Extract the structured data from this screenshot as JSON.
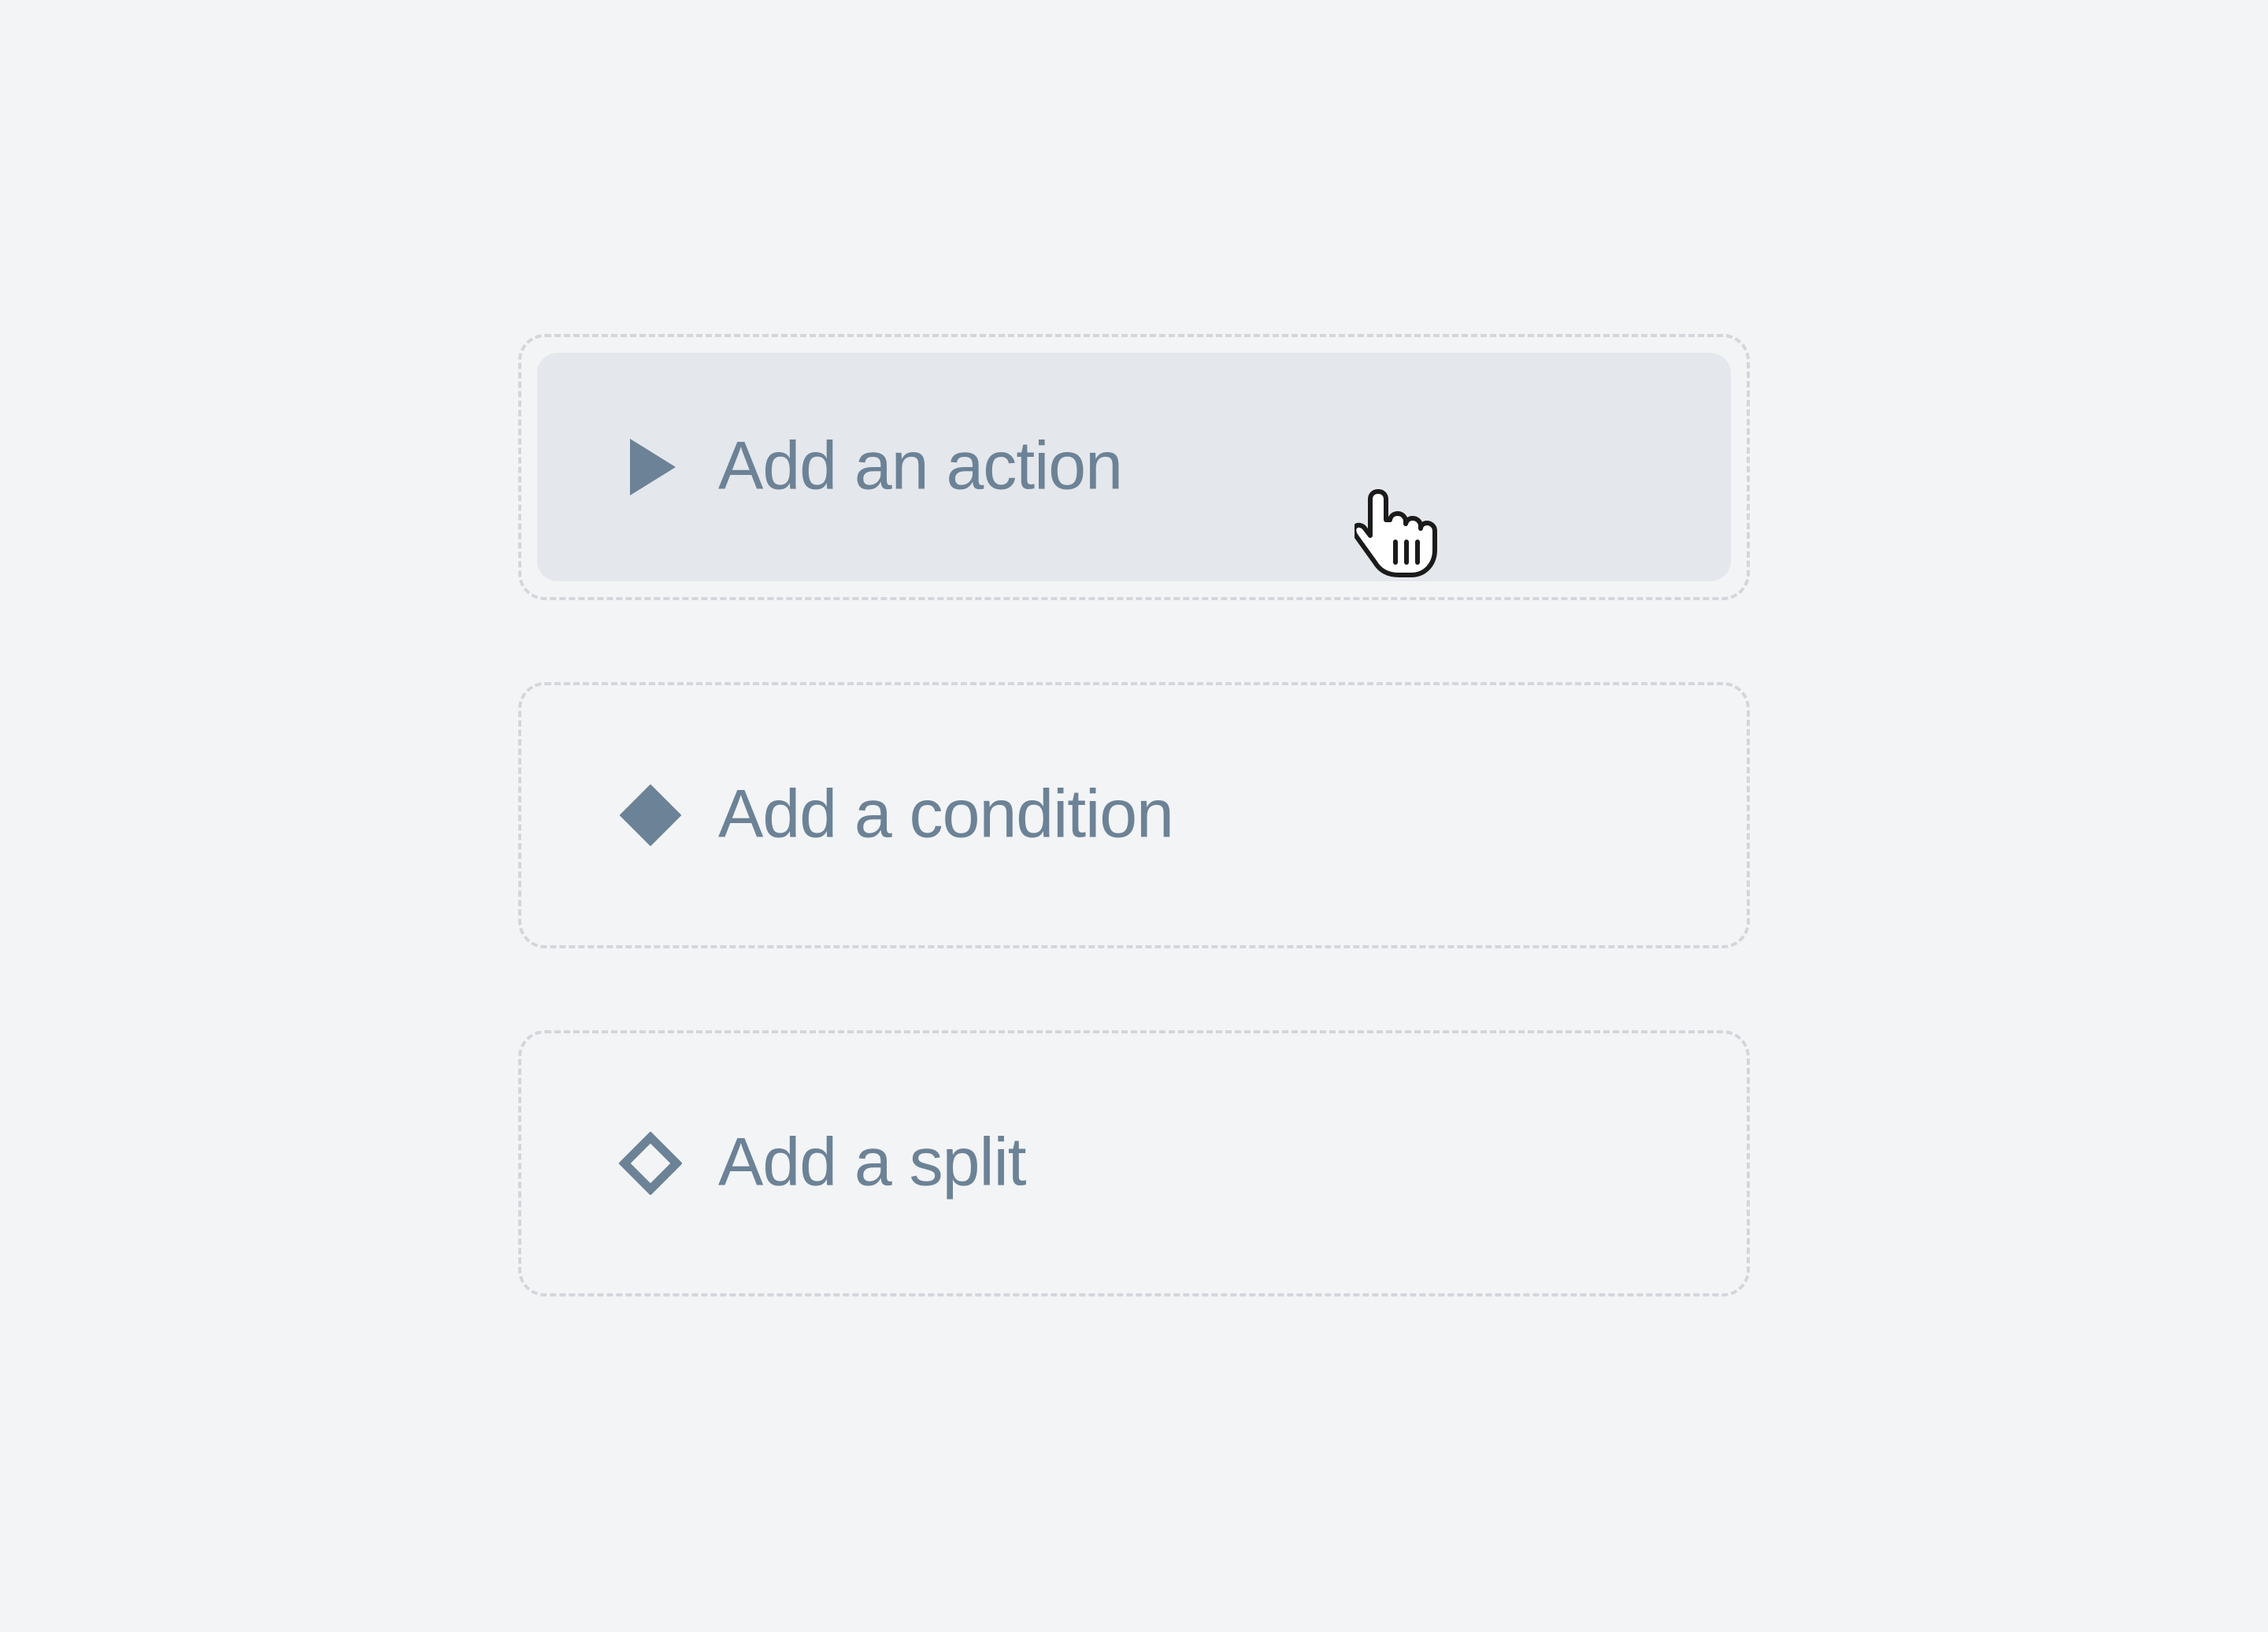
{
  "theme": {
    "accent": "#6c8296",
    "background": "#f3f4f6",
    "hover_background": "#e4e7eb",
    "dashed_border": "#d3d6db"
  },
  "options": [
    {
      "icon": "play-icon",
      "label": "Add an action",
      "hovered": true
    },
    {
      "icon": "filled-diamond-icon",
      "label": "Add a condition",
      "hovered": false
    },
    {
      "icon": "outline-diamond-icon",
      "label": "Add a split",
      "hovered": false
    }
  ],
  "cursor": {
    "icon": "hand-pointer-icon"
  }
}
